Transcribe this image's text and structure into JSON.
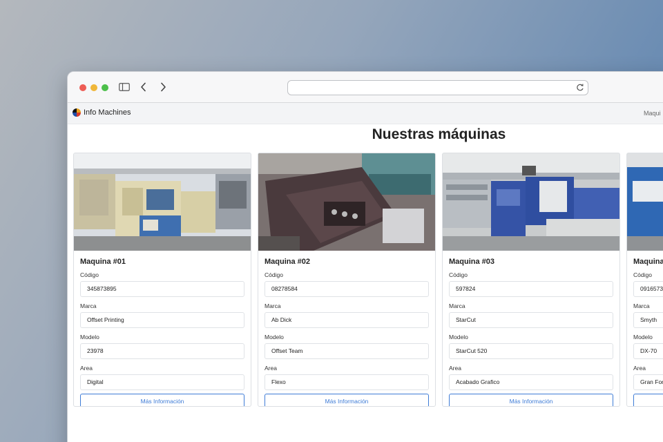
{
  "browser": {
    "url": "",
    "icons": [
      "sidebar-icon",
      "back-icon",
      "forward-icon",
      "reload-icon"
    ]
  },
  "navbar": {
    "brand": "Info Machines",
    "link": "Maqui"
  },
  "page": {
    "title": "Nuestras máquinas"
  },
  "labels": {
    "codigo": "Código",
    "marca": "Marca",
    "modelo": "Modelo",
    "area": "Area",
    "button": "Más Información"
  },
  "machines": [
    {
      "title": "Maquina #01",
      "codigo": "345873895",
      "marca": "Offset Printing",
      "modelo": "23978",
      "area": "Digital"
    },
    {
      "title": "Maquina #02",
      "codigo": "08278584",
      "marca": "Ab Dick",
      "modelo": "Offset Team",
      "area": "Flexo"
    },
    {
      "title": "Maquina #03",
      "codigo": "597824",
      "marca": "StarCut",
      "modelo": "StarCut 520",
      "area": "Acabado Grafico"
    },
    {
      "title": "Maquina",
      "codigo": "0916573",
      "marca": "Smyth",
      "modelo": "DX-70",
      "area": "Gran For"
    }
  ],
  "colors": {
    "accent": "#3d7bd6",
    "dot_red": "#ee5d55",
    "dot_yellow": "#f0b73a",
    "dot_green": "#4cbf4a"
  }
}
